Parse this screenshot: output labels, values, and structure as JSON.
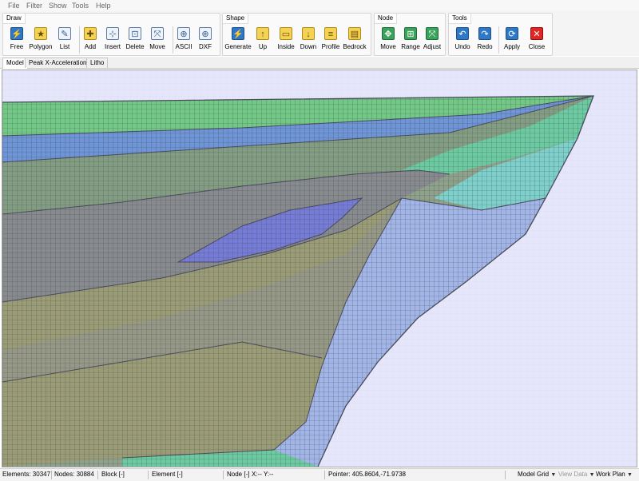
{
  "menu": [
    "File",
    "Filter",
    "Show",
    "Tools",
    "Help"
  ],
  "ribbon": {
    "draw": {
      "label": "Draw",
      "free": "Free",
      "polygon": "Polygon",
      "list": "List",
      "add": "Add",
      "insert": "Insert",
      "delete": "Delete",
      "move": "Move",
      "ascii": "ASCII",
      "dxf": "DXF"
    },
    "shape": {
      "label": "Shape",
      "generate": "Generate",
      "up": "Up",
      "inside": "Inside",
      "down": "Down",
      "profile": "Profile",
      "bedrock": "Bedrock"
    },
    "node": {
      "label": "Node",
      "move": "Move",
      "range": "Range",
      "adjust": "Adjust"
    },
    "tools": {
      "label": "Tools",
      "undo": "Undo",
      "redo": "Redo",
      "apply": "Apply",
      "close": "Close"
    }
  },
  "tabs": [
    "Model",
    "Peak X-Acceleration (g)",
    "Litho"
  ],
  "active_tab": "Model",
  "status": {
    "elements": "Elements: 30347",
    "nodes": "Nodes: 30884",
    "block": "Block [-]",
    "element": "Element [-]",
    "node": "Node [-]",
    "xy": "X:-- Y:--",
    "pointer": "Pointer: 405.8604,-71.9738",
    "model_grid": "Model Grid",
    "view_data": "View Data",
    "work_plan": "Work Plan"
  },
  "colors": {
    "background": "#e6e6fb",
    "green": "#73c888",
    "blue": "#6f94d8",
    "gray_green": "#849c84",
    "gray": "#888a90",
    "olive": "#9c9b78",
    "purple": "#777bd8",
    "teal": "#7fcfcd",
    "lavender": "#a3b4e8",
    "cyan_green": "#6dc9a2",
    "mesh_line": "#3b5a3f",
    "boundary": "#4a4a5a"
  }
}
